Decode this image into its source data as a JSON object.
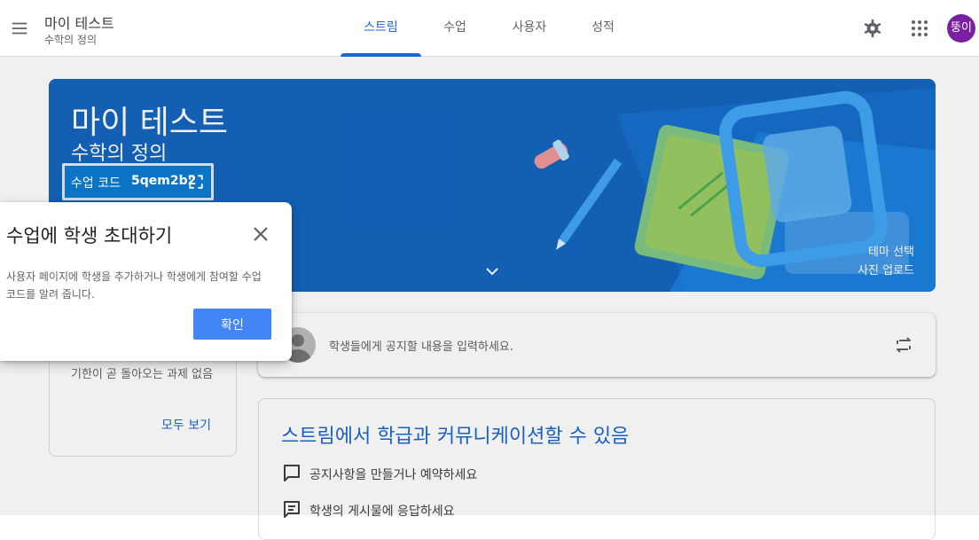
{
  "header": {
    "class_title": "마이 테스트",
    "class_section": "수학의 정의",
    "avatar_text": "뚱이",
    "tabs": [
      {
        "label": "스트림",
        "active": true
      },
      {
        "label": "수업",
        "active": false
      },
      {
        "label": "사용자",
        "active": false
      },
      {
        "label": "성적",
        "active": false
      }
    ]
  },
  "banner": {
    "title": "마이 테스트",
    "section": "수학의 정의",
    "class_code_label": "수업 코드",
    "class_code": "5qem2b2",
    "theme_link": "테마 선택",
    "photo_link": "사진 업로드"
  },
  "popup": {
    "title": "수업에 학생 초대하기",
    "body": "사용자 페이지에 학생을 추가하거나 학생에게 참여할 수업 코드를 알려 줍니다.",
    "ok_button": "확인"
  },
  "upcoming": {
    "empty_text": "기한이 곧 돌아오는 과제 없음",
    "view_all": "모두 보기"
  },
  "announce": {
    "placeholder": "학생들에게 공지할 내용을 입력하세요."
  },
  "info": {
    "title": "스트림에서 학급과 커뮤니케이션할 수 있음",
    "items": [
      {
        "label": "공지사항을 만들거나 예약하세요",
        "icon": "comment-icon"
      },
      {
        "label": "학생의 게시물에 응답하세요",
        "icon": "feedback-icon"
      }
    ]
  },
  "icons": {
    "menu": "menu-icon",
    "settings": "gear-icon",
    "apps": "apps-grid-icon",
    "fullscreen": "fullscreen-icon",
    "expand": "chevron-down-icon",
    "close": "close-icon",
    "user": "user-avatar-icon",
    "repost": "repost-icon"
  },
  "colors": {
    "accent": "#1967d2",
    "banner": "#1565c0",
    "avatar": "#7b1fa2",
    "ok_button": "#4285f4"
  }
}
